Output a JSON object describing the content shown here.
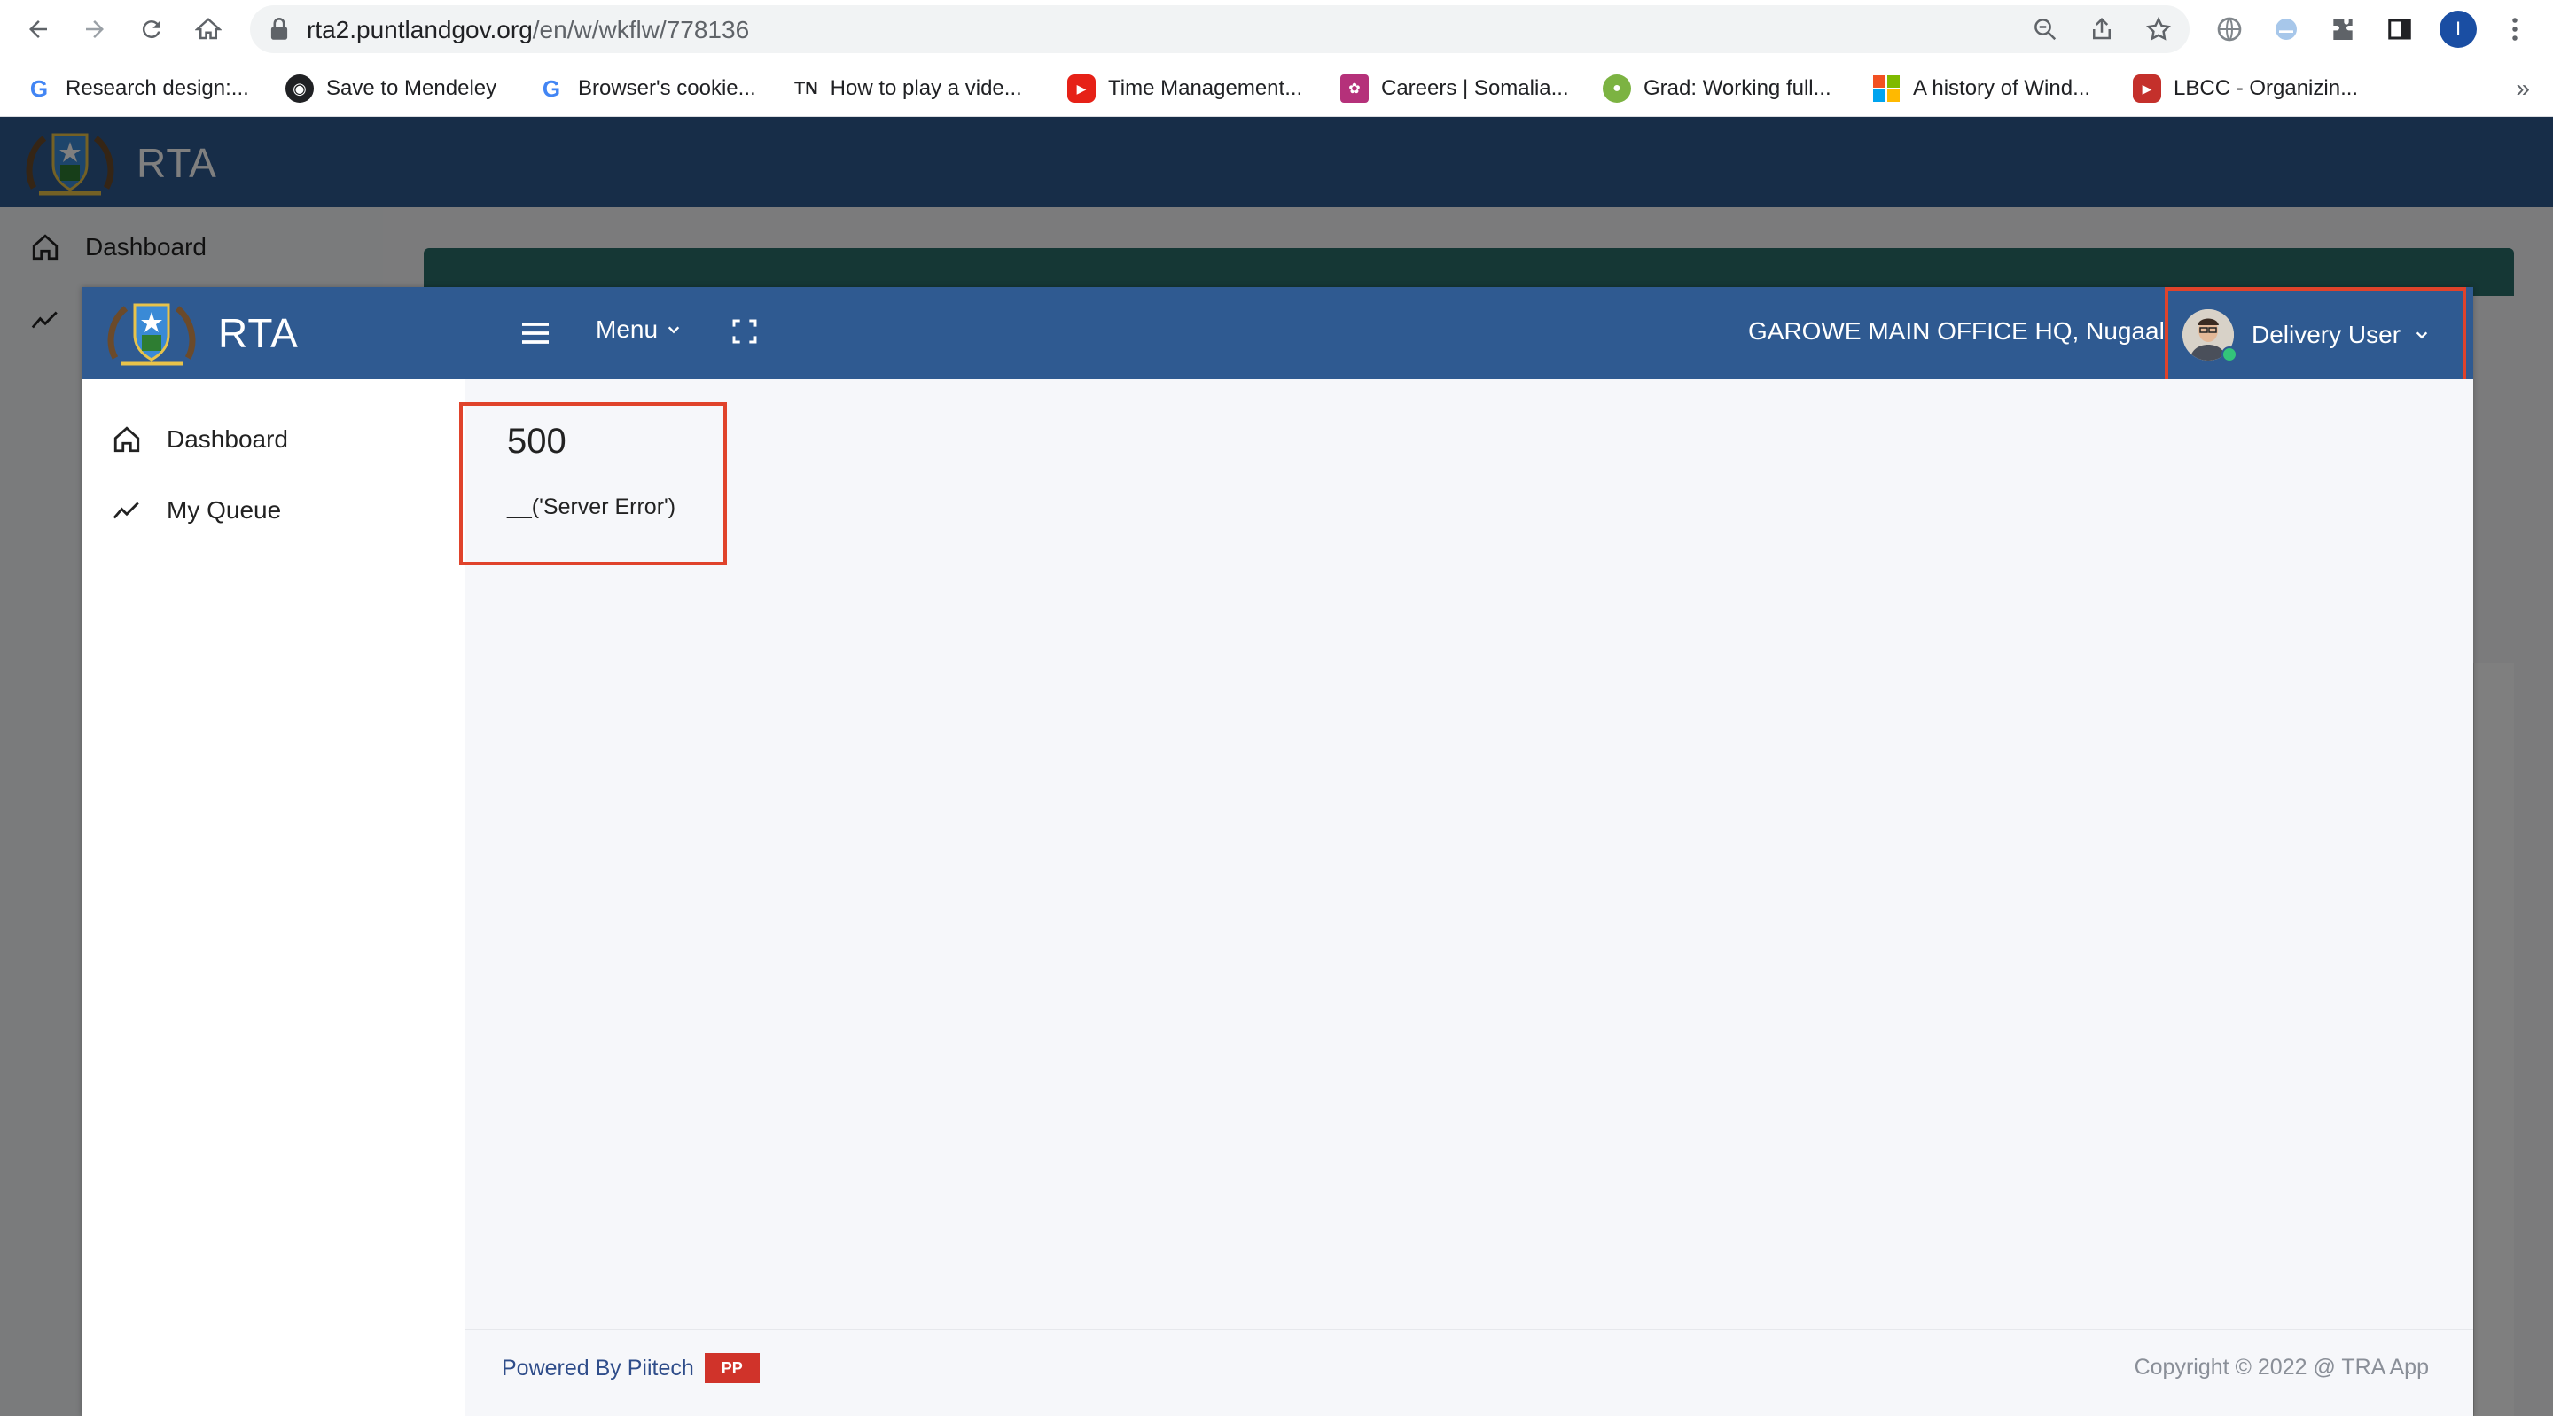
{
  "browser": {
    "url_host": "rta2.puntlandgov.org",
    "url_path": "/en/w/wkflw/778136",
    "profile_initial": "I",
    "bookmarks": [
      {
        "label": "Research design:...",
        "icon": "google-icon"
      },
      {
        "label": "Save to Mendeley",
        "icon": "globe-icon"
      },
      {
        "label": "Browser's cookie...",
        "icon": "google-icon"
      },
      {
        "label": "How to play a vide...",
        "icon": "tn-icon",
        "prefix": "TN"
      },
      {
        "label": "Time Management...",
        "icon": "youtube-icon"
      },
      {
        "label": "Careers | Somalia...",
        "icon": "careers-icon"
      },
      {
        "label": "Grad: Working full...",
        "icon": "grad-icon"
      },
      {
        "label": "A history of Wind...",
        "icon": "windows-icon"
      },
      {
        "label": "LBCC - Organizin...",
        "icon": "youtube-icon"
      }
    ],
    "more_label": "»"
  },
  "app": {
    "brand": "RTA",
    "menu_label": "Menu",
    "office": "GAROWE MAIN OFFICE HQ, Nugaal",
    "user_name": "Delivery User",
    "sidebar": {
      "items": [
        {
          "label": "Dashboard",
          "icon": "home-icon"
        },
        {
          "label": "My Queue",
          "icon": "trend-icon"
        }
      ]
    },
    "background_sidebar_label": "Dashboard",
    "error": {
      "code": "500",
      "message": "__('Server Error')"
    },
    "footer": {
      "powered_by": "Powered By Piitech",
      "logo_text": "PP",
      "copyright": "Copyright © 2022 @ TRA App"
    }
  },
  "colors": {
    "header_blue": "#2f5a91",
    "highlight_red": "#e0432b",
    "status_green": "#33c47a"
  }
}
